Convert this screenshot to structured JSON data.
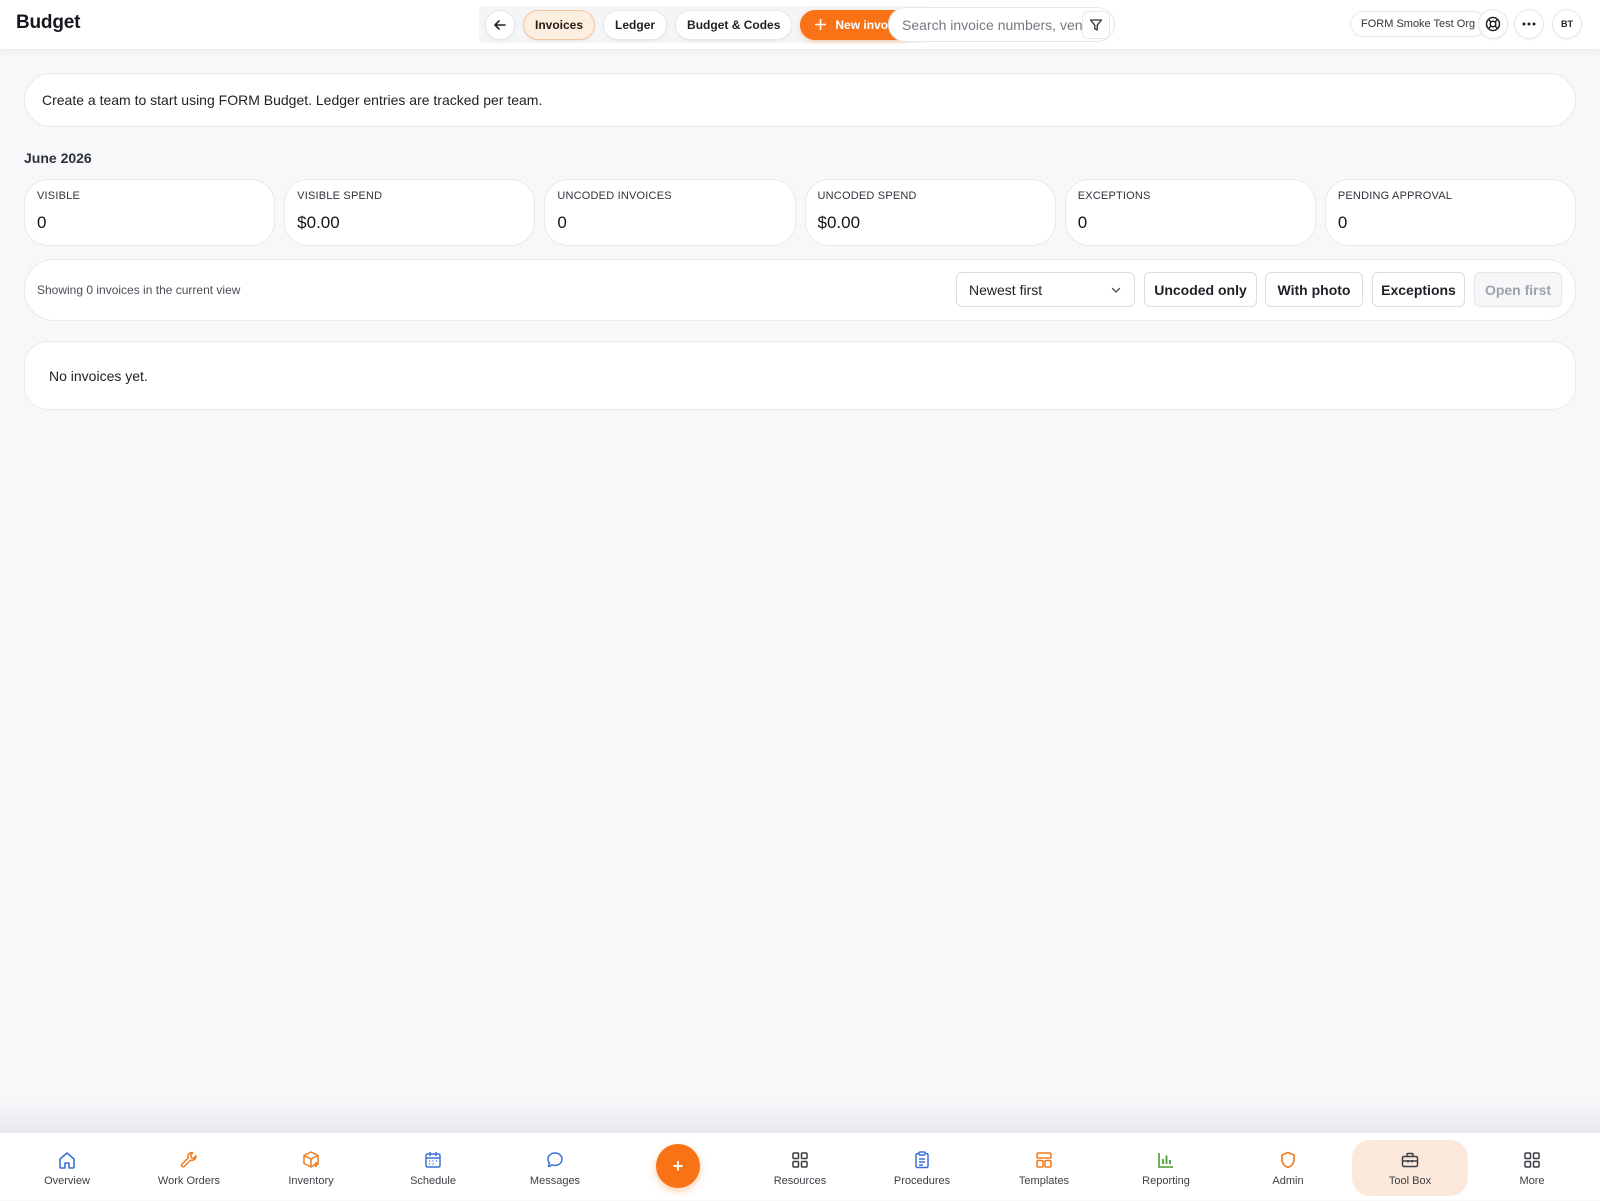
{
  "app": {
    "title": "Budget"
  },
  "header": {
    "tabs": [
      {
        "label": "Invoices",
        "active": true
      },
      {
        "label": "Ledger",
        "active": false
      },
      {
        "label": "Budget & Codes",
        "active": false
      }
    ],
    "new_invoice_label": "New invoice",
    "search_placeholder": "Search invoice numbers, vendors...",
    "org_name": "FORM Smoke Test Org",
    "avatar_initials": "BT"
  },
  "banner": {
    "text": "Create a team to start using FORM Budget. Ledger entries are tracked per team."
  },
  "period": {
    "label": "June 2026"
  },
  "stats": [
    {
      "label": "VISIBLE",
      "value": "0"
    },
    {
      "label": "VISIBLE SPEND",
      "value": "$0.00"
    },
    {
      "label": "UNCODED INVOICES",
      "value": "0"
    },
    {
      "label": "UNCODED SPEND",
      "value": "$0.00"
    },
    {
      "label": "EXCEPTIONS",
      "value": "0"
    },
    {
      "label": "PENDING APPROVAL",
      "value": "0"
    }
  ],
  "toolbar": {
    "showing_text": "Showing 0 invoices in the current view",
    "sort_value": "Newest first",
    "filters": [
      {
        "label": "Uncoded only"
      },
      {
        "label": "With photo"
      },
      {
        "label": "Exceptions"
      }
    ],
    "open_first_label": "Open first"
  },
  "empty_state": {
    "text": "No invoices yet."
  },
  "bottom_nav": {
    "items": [
      {
        "label": "Overview",
        "icon": "home-icon"
      },
      {
        "label": "Work Orders",
        "icon": "wrench-icon"
      },
      {
        "label": "Inventory",
        "icon": "box-icon"
      },
      {
        "label": "Schedule",
        "icon": "calendar-icon"
      },
      {
        "label": "Messages",
        "icon": "chat-icon"
      },
      {
        "label": "Resources",
        "icon": "grid-icon"
      },
      {
        "label": "Procedures",
        "icon": "clipboard-icon"
      },
      {
        "label": "Templates",
        "icon": "layout-icon"
      },
      {
        "label": "Reporting",
        "icon": "bar-chart-icon"
      },
      {
        "label": "Admin",
        "icon": "shield-icon"
      },
      {
        "label": "Tool Box",
        "icon": "toolbox-icon",
        "active": true
      },
      {
        "label": "More",
        "icon": "grid-icon"
      }
    ],
    "fab_label": "+"
  },
  "colors": {
    "accent": "#f97316",
    "active_tab_bg": "#fdeee2",
    "active_nav_bg": "#fbe8db",
    "page_bg": "#f7f8fa",
    "icon_blue": "#3b6fd8",
    "icon_orange": "#f07a1c",
    "icon_green": "#4a9c2f"
  }
}
